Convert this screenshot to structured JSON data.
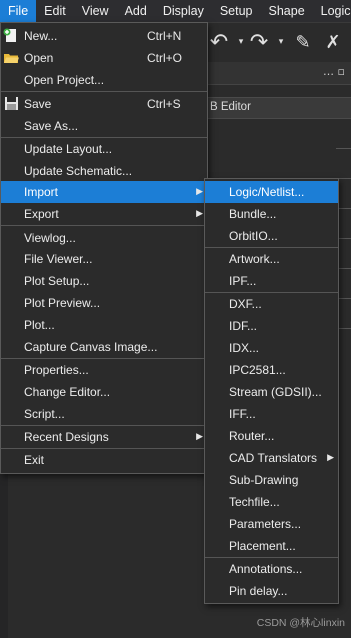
{
  "menubar": [
    "File",
    "Edit",
    "View",
    "Add",
    "Display",
    "Setup",
    "Shape",
    "Logic"
  ],
  "background": {
    "editor_tab": "B Editor"
  },
  "file_menu": {
    "items": [
      {
        "label": "New...",
        "shortcut": "Ctrl+N",
        "icon": "new-file-icon"
      },
      {
        "label": "Open",
        "shortcut": "Ctrl+O",
        "icon": "open-folder-icon"
      },
      {
        "label": "Open Project..."
      },
      {
        "label": "Save",
        "shortcut": "Ctrl+S",
        "icon": "save-disk-icon"
      },
      {
        "label": "Save As..."
      },
      {
        "label": "Update Layout..."
      },
      {
        "label": "Update Schematic..."
      },
      {
        "label": "Import",
        "submenu": true,
        "highlighted": true
      },
      {
        "label": "Export",
        "submenu": true
      },
      {
        "label": "Viewlog..."
      },
      {
        "label": "File Viewer..."
      },
      {
        "label": "Plot Setup..."
      },
      {
        "label": "Plot Preview..."
      },
      {
        "label": "Plot..."
      },
      {
        "label": "Capture Canvas Image..."
      },
      {
        "label": "Properties..."
      },
      {
        "label": "Change Editor..."
      },
      {
        "label": "Script..."
      },
      {
        "label": "Recent Designs",
        "submenu": true
      },
      {
        "label": "Exit"
      }
    ]
  },
  "import_menu": {
    "items": [
      {
        "label": "Logic/Netlist...",
        "highlighted": true
      },
      {
        "label": "Bundle..."
      },
      {
        "label": "OrbitIO..."
      },
      {
        "label": "Artwork..."
      },
      {
        "label": "IPF..."
      },
      {
        "label": "DXF..."
      },
      {
        "label": "IDF..."
      },
      {
        "label": "IDX..."
      },
      {
        "label": "IPC2581..."
      },
      {
        "label": "Stream (GDSII)..."
      },
      {
        "label": "IFF..."
      },
      {
        "label": "Router..."
      },
      {
        "label": "CAD Translators",
        "submenu": true
      },
      {
        "label": "Sub-Drawing"
      },
      {
        "label": "Techfile..."
      },
      {
        "label": "Parameters..."
      },
      {
        "label": "Placement..."
      },
      {
        "label": "Annotations..."
      },
      {
        "label": "Pin delay..."
      }
    ]
  },
  "watermark": "CSDN @林心linxin",
  "colors": {
    "highlight": "#1c7ed6",
    "menu_bg": "#2b2b2b",
    "text": "#ececec"
  }
}
